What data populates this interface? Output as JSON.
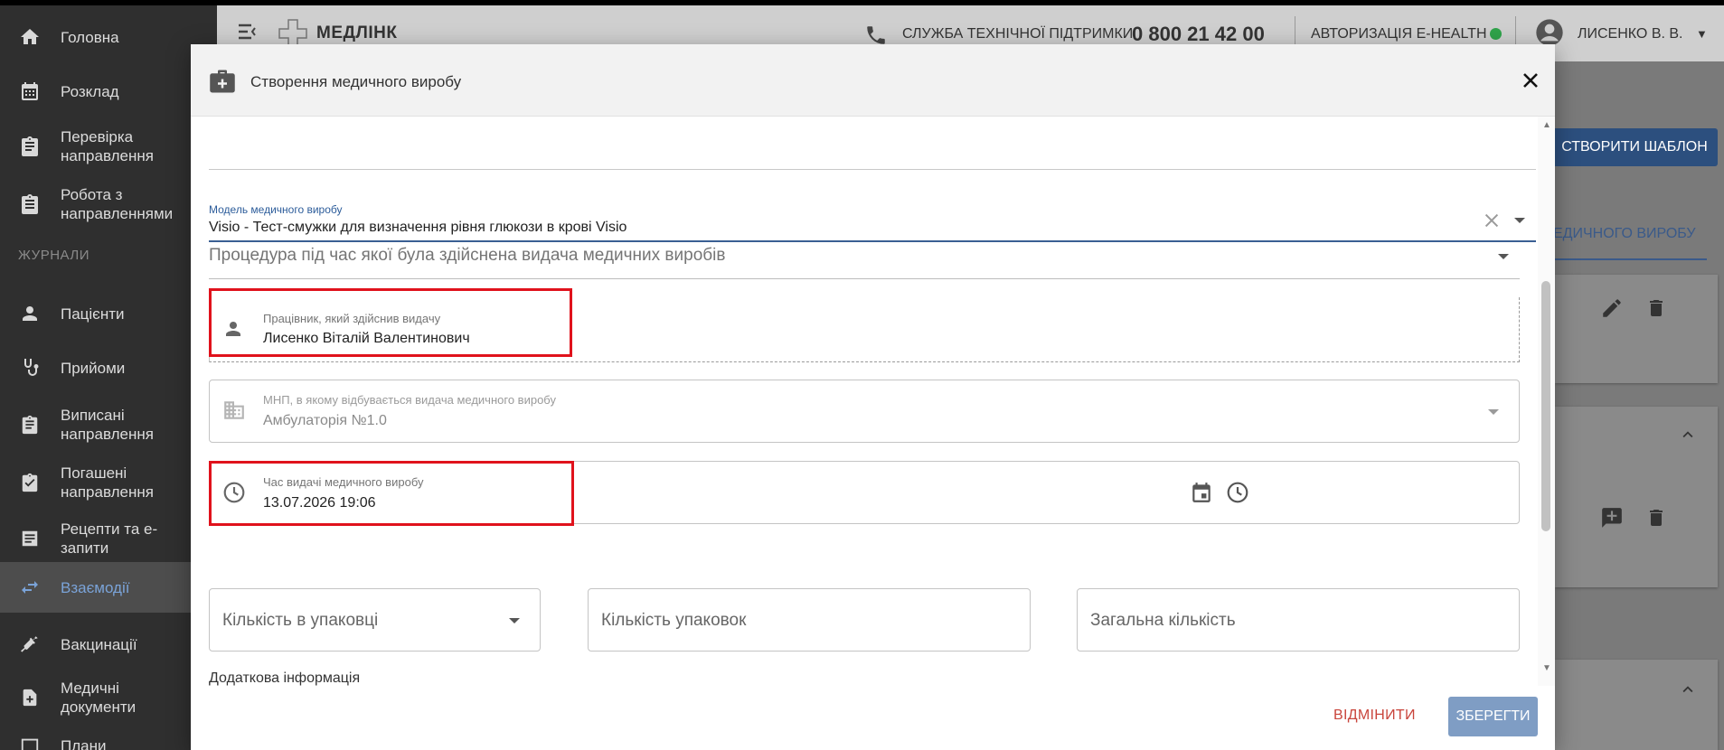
{
  "sidebar": {
    "items": [
      {
        "label": "Головна",
        "icon": "home-icon"
      },
      {
        "label": "Розклад",
        "icon": "calendar-icon"
      },
      {
        "label": "Перевірка\nнаправлення",
        "icon": "clipboard-icon"
      },
      {
        "label": "Робота з\nнаправленнями",
        "icon": "clipboard-list-icon"
      }
    ],
    "section": "ЖУРНАЛИ",
    "journal_items": [
      {
        "label": "Пацієнти",
        "icon": "person-icon"
      },
      {
        "label": "Прийоми",
        "icon": "stethoscope-icon"
      },
      {
        "label": "Виписані\nнаправлення",
        "icon": "clipboard-icon"
      },
      {
        "label": "Погашені\nнаправлення",
        "icon": "clipboard-check-icon"
      },
      {
        "label": "Рецепти та е-\nзапити",
        "icon": "list-icon"
      },
      {
        "label": "Взаємодії",
        "icon": "swap-icon",
        "active": true
      },
      {
        "label": "Вакцинації",
        "icon": "syringe-icon"
      },
      {
        "label": "Медичні\nдокументи",
        "icon": "document-plus-icon"
      },
      {
        "label": "Плани",
        "icon": "plan-icon"
      }
    ]
  },
  "appbar": {
    "brand": "МЕДЛІНК",
    "support_label": "СЛУЖБА ТЕХНІЧНОЇ ПІДТРИМКИ",
    "support_phone": "0 800 21 42 00",
    "ehealth_label": "АВТОРИЗАЦІЯ E-HEALTH",
    "ehealth_status_color": "#2fa34a",
    "user_name": "ЛИСЕНКО В. В."
  },
  "background": {
    "create_template_button": "СТВОРИТИ ШАБЛОН",
    "tab_label": "ЕДИЧНОГО ВИРОБУ"
  },
  "dialog": {
    "title": "Створення медичного виробу",
    "model_label": "Модель медичного виробу",
    "model_value": "Visio - Тест-смужки для визначення рівня глюкози в крові Visio",
    "procedure_placeholder": "Процедура під час якої була здійснена видача медичних виробів",
    "employee_label": "Працівник, який здійснив видачу",
    "employee_value": "Лисенко Віталій Валентинович",
    "facility_label": "МНП, в якому відбувається видача медичного виробу",
    "facility_value": "Амбулаторія №1.0",
    "time_label": "Час видачі медичного виробу",
    "time_value": "13.07.2026 19:06",
    "qty_in_pack_placeholder": "Кількість в упаковці",
    "packs_placeholder": "Кількість упаковок",
    "total_placeholder": "Загальна кількість",
    "additional_info": "Додаткова інформація",
    "cancel_button": "ВІДМІНИТИ",
    "save_button": "ЗБЕРЕГТИ"
  },
  "colors": {
    "accent": "#2c4f7e",
    "highlight_box": "#e0121c",
    "cancel": "#c9453c"
  }
}
